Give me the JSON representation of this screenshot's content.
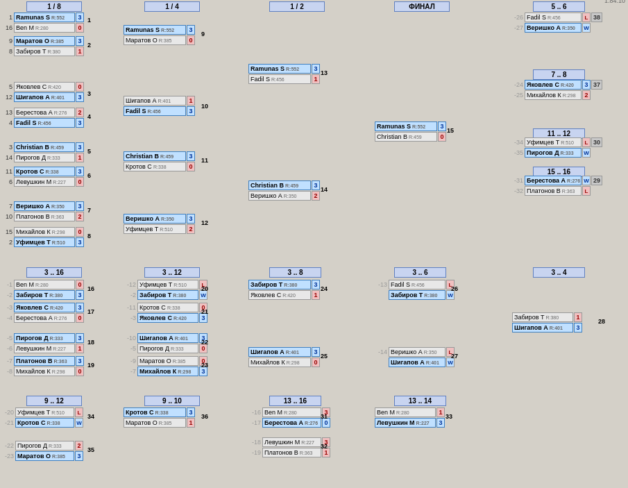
{
  "titles": {
    "t18": "1 / 8",
    "t14": "1 / 4",
    "t12": "1 / 2",
    "final": "ФИНАЛ",
    "t56": "5 .. 6",
    "t78": "7 .. 8",
    "t1112": "11 .. 12",
    "t1516": "15 .. 16",
    "t316": "3 .. 16",
    "t312": "3 .. 12",
    "t38": "3 .. 8",
    "t36": "3 .. 6",
    "t34": "3 .. 4",
    "t912": "9 .. 12",
    "t910": "9 .. 10",
    "t1316": "13 .. 16",
    "t1314": "13 .. 14"
  },
  "version": "1.84.10"
}
